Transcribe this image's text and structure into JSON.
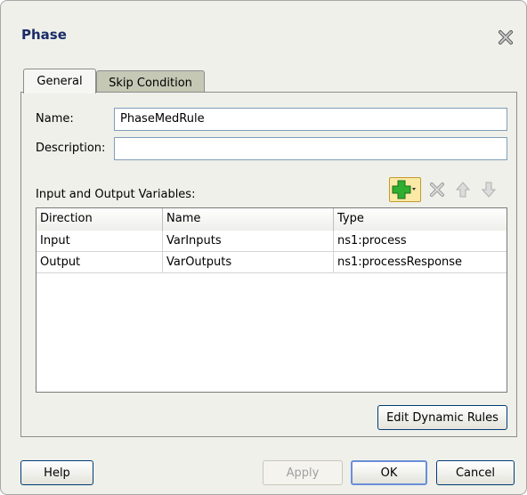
{
  "dialog": {
    "title": "Phase",
    "tabs": [
      {
        "label": "General",
        "selected": true
      },
      {
        "label": "Skip Condition",
        "selected": false
      }
    ],
    "name_label": "Name:",
    "name_value": "PhaseMedRule",
    "description_label": "Description:",
    "description_value": "",
    "variables_label": "Input and Output Variables:",
    "table": {
      "columns": [
        "Direction",
        "Name",
        "Type"
      ],
      "rows": [
        [
          "Input",
          "VarInputs",
          "ns1:process"
        ],
        [
          "Output",
          "VarOutputs",
          "ns1:processResponse"
        ]
      ]
    },
    "edit_rules_label": "Edit Dynamic Rules",
    "buttons": {
      "help": "Help",
      "apply": "Apply",
      "ok": "OK",
      "cancel": "Cancel"
    },
    "icons": [
      "close-icon",
      "add-icon",
      "delete-icon",
      "move-up-icon",
      "move-down-icon"
    ],
    "colors": {
      "title": "#1a2c66",
      "add_green": "#2fae2f",
      "default_border": "#6a8ed8"
    }
  }
}
